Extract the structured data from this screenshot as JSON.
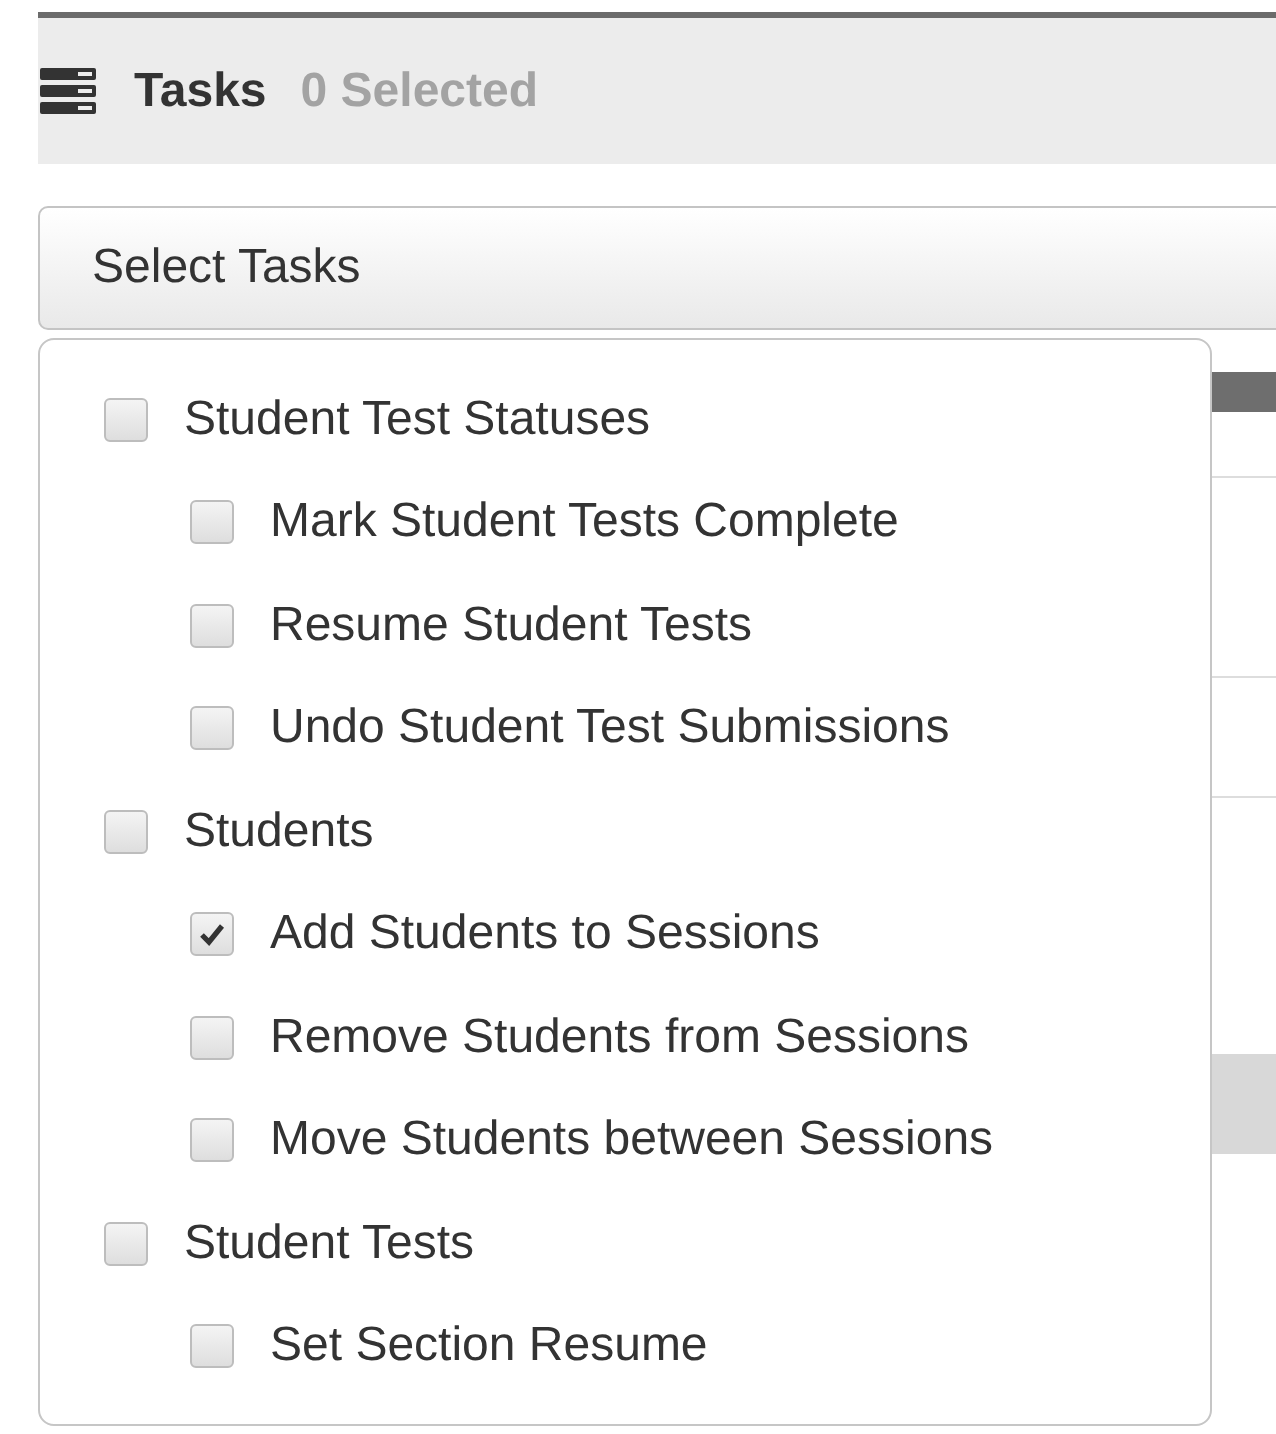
{
  "header": {
    "title": "Tasks",
    "count": "0 Selected"
  },
  "select": {
    "label": "Select Tasks",
    "expanded": true
  },
  "options": [
    {
      "label": "Student Test Statuses",
      "checked": false,
      "children": [
        {
          "label": "Mark Student Tests Complete",
          "checked": false
        },
        {
          "label": "Resume Student Tests",
          "checked": false
        },
        {
          "label": "Undo Student Test Submissions",
          "checked": false
        }
      ]
    },
    {
      "label": "Students",
      "checked": false,
      "children": [
        {
          "label": "Add Students to Sessions",
          "checked": true
        },
        {
          "label": "Remove Students from Sessions",
          "checked": false
        },
        {
          "label": "Move Students between Sessions",
          "checked": false
        }
      ]
    },
    {
      "label": "Student Tests",
      "checked": false,
      "children": [
        {
          "label": "Set Section Resume",
          "checked": false
        }
      ]
    }
  ]
}
